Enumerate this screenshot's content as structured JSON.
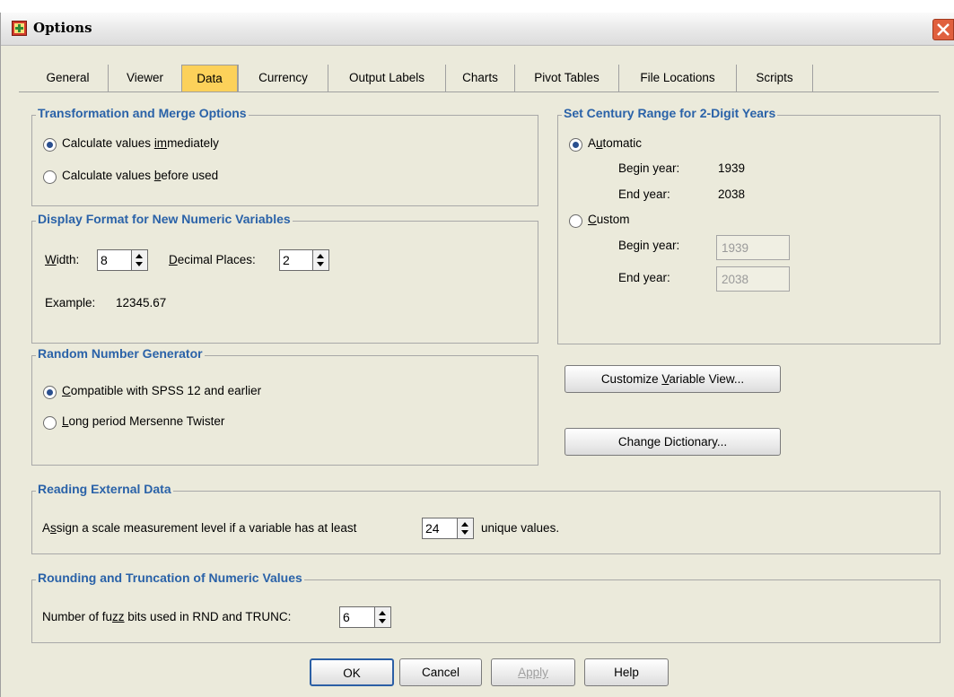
{
  "window": {
    "title": "Options",
    "accent_color": "#2a62a8",
    "active_tab_color": "#fcd15a"
  },
  "tabs": [
    {
      "label": "General"
    },
    {
      "label": "Viewer"
    },
    {
      "label": "Data"
    },
    {
      "label": "Currency"
    },
    {
      "label": "Output Labels"
    },
    {
      "label": "Charts"
    },
    {
      "label": "Pivot Tables"
    },
    {
      "label": "File Locations"
    },
    {
      "label": "Scripts"
    }
  ],
  "active_tab": "Data",
  "transformation": {
    "title": "Transformation and Merge Options",
    "immediate_pre": "Calculate values ",
    "immediate_u": "im",
    "immediate_post": "mediately",
    "before_pre": "Calculate values ",
    "before_u": "b",
    "before_post": "efore used",
    "selected": "immediately"
  },
  "display_format": {
    "title": "Display Format for New Numeric Variables",
    "width_u": "W",
    "width_post": "idth:",
    "width_value": "8",
    "decimal_u": "D",
    "decimal_post": "ecimal Places:",
    "decimal_value": "2",
    "example_label": "Example:",
    "example_value": "12345.67"
  },
  "century": {
    "title": "Set Century Range for 2-Digit Years",
    "automatic_pre": "A",
    "automatic_u": "u",
    "automatic_post": "tomatic",
    "begin_label": "Begin year:",
    "begin_value": "1939",
    "end_label": "End year:",
    "end_value": "2038",
    "custom_u": "C",
    "custom_post": "ustom",
    "custom_begin_label": "Begin year:",
    "custom_begin_value": "1939",
    "custom_end_label": "End year:",
    "custom_end_value": "2038",
    "selected": "automatic"
  },
  "rng": {
    "title": "Random Number Generator",
    "compatible_u": "C",
    "compatible_post": "ompatible with SPSS 12 and earlier",
    "mersenne_u": "L",
    "mersenne_post": "ong period Mersenne Twister",
    "selected": "compatible"
  },
  "buttons": {
    "customize_pre": "Customize ",
    "customize_u": "V",
    "customize_post": "ariable View...",
    "dictionary_pre": "Chan",
    "dictionary_u": "g",
    "dictionary_post": "e Dictionary...",
    "ok": "OK",
    "cancel": "Cancel",
    "apply": "Apply",
    "help": "Help"
  },
  "external": {
    "title": "Reading External Data",
    "text_pre": "A",
    "text_u": "s",
    "text_post": "sign a scale measurement level if a variable has at least",
    "value": "24",
    "text_after": "unique values."
  },
  "rounding": {
    "title": "Rounding and Truncation of Numeric Values",
    "text_pre": "Number of fu",
    "text_u": "zz",
    "text_post": " bits used in RND and TRUNC:",
    "value": "6"
  }
}
